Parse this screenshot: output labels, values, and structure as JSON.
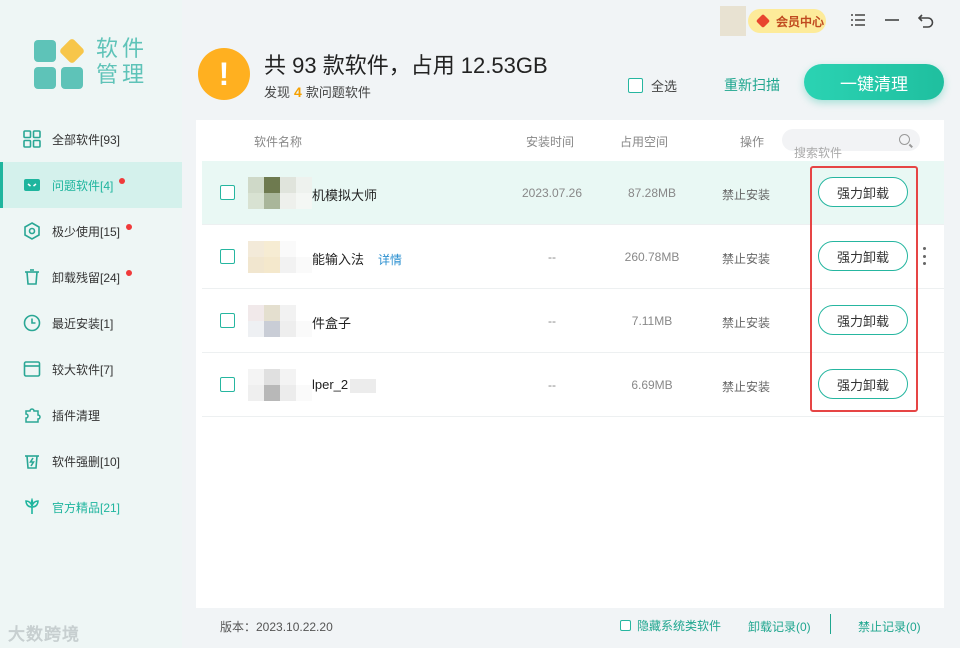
{
  "app": {
    "title_line1": "软件",
    "title_line2": "管理"
  },
  "colors": {
    "accent": "#1fb59e",
    "warning": "#ffb020",
    "highlight_box": "#e64545"
  },
  "topbar": {
    "vip_label": "会员中心",
    "menu_icon": "list-icon",
    "minimize_icon": "minimize-icon",
    "back_icon": "back-arrow-icon"
  },
  "sidebar": {
    "items": [
      {
        "label": "全部软件[93]",
        "icon": "grid-icon",
        "dot": false
      },
      {
        "label": "问题软件[4]",
        "icon": "problem-icon",
        "dot": true
      },
      {
        "label": "极少使用[15]",
        "icon": "hexagon-icon",
        "dot": true
      },
      {
        "label": "卸载残留[24]",
        "icon": "trash-icon",
        "dot": true
      },
      {
        "label": "最近安装[1]",
        "icon": "clock-icon",
        "dot": false
      },
      {
        "label": "较大软件[7]",
        "icon": "window-icon",
        "dot": false
      },
      {
        "label": "插件清理",
        "icon": "puzzle-icon",
        "dot": false
      },
      {
        "label": "软件强删[10]",
        "icon": "bolt-trash-icon",
        "dot": false
      },
      {
        "label": "官方精品[21]",
        "icon": "flower-icon",
        "dot": false
      }
    ],
    "watermark": "大数跨境"
  },
  "header": {
    "headline": "共 93 款软件，占用 12.53GB",
    "sub_prefix": "发现",
    "sub_count": "4",
    "sub_suffix": "款问题软件",
    "select_all": "全选",
    "rescan": "重新扫描",
    "clean_button": "一键清理"
  },
  "table": {
    "columns": {
      "name": "软件名称",
      "time": "安装时间",
      "size": "占用空间",
      "op": "操作"
    },
    "search_placeholder": "搜索软件",
    "rows": [
      {
        "name": "机模拟大师",
        "detail": "",
        "time": "2023.07.26",
        "size": "87.28MB",
        "op": "禁止安装",
        "action": "强力卸载"
      },
      {
        "name": "能输入法",
        "detail": "详情",
        "time": "--",
        "size": "260.78MB",
        "op": "禁止安装",
        "action": "强力卸载"
      },
      {
        "name": "件盒子",
        "detail": "",
        "time": "--",
        "size": "7.11MB",
        "op": "禁止安装",
        "action": "强力卸载"
      },
      {
        "name": "lper_2",
        "detail": "",
        "time": "--",
        "size": "6.69MB",
        "op": "禁止安装",
        "action": "强力卸载"
      }
    ]
  },
  "footer": {
    "version": "版本：2023.10.22.20",
    "hide_system": "隐藏系统类软件",
    "uninstall_log": "卸载记录(0)",
    "ban_log": "禁止记录(0)"
  }
}
